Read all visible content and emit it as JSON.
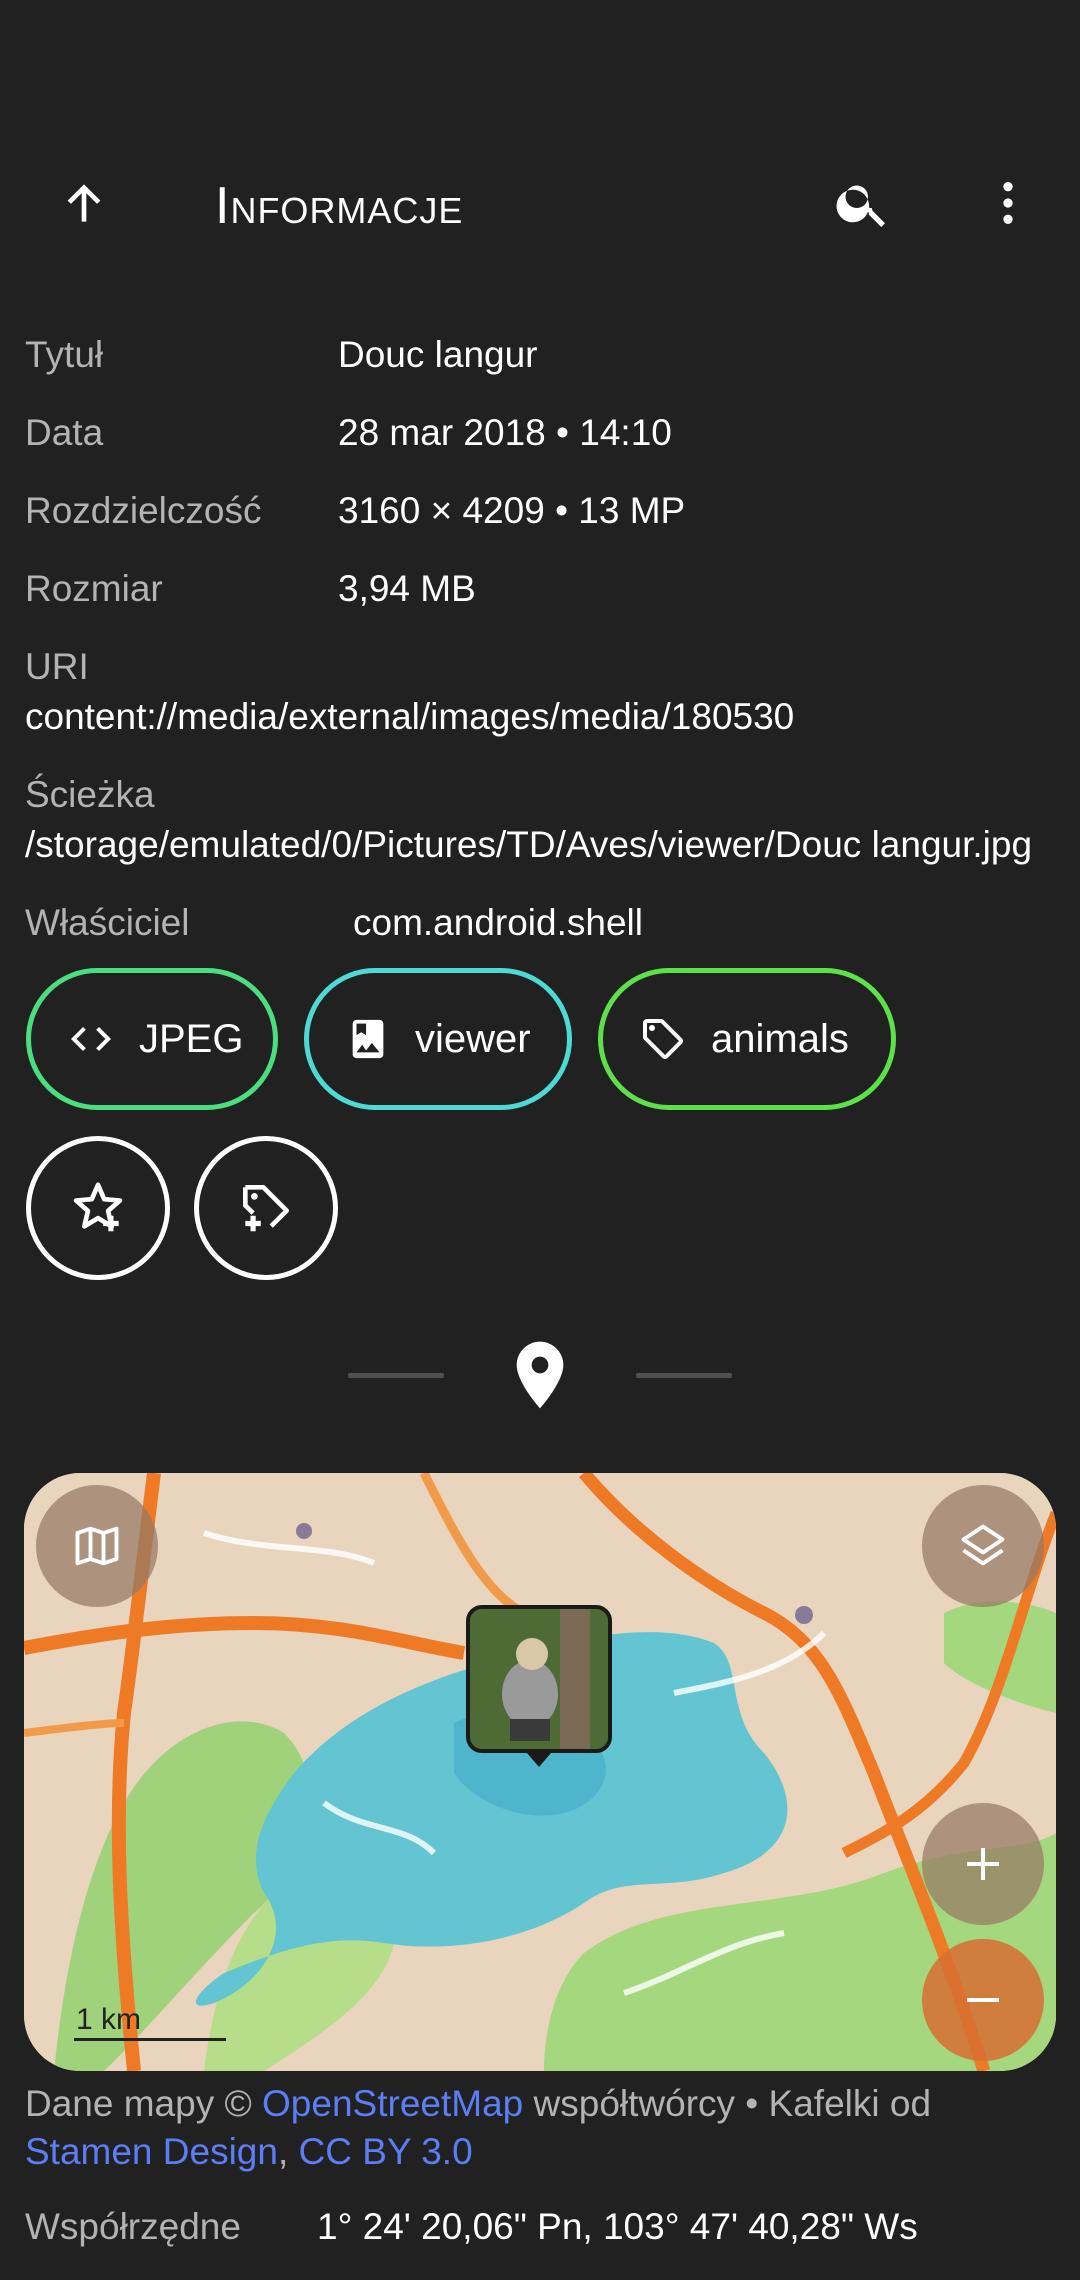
{
  "app_bar": {
    "title": "Informacje",
    "back_icon": "arrow-up-icon",
    "search_icon": "search-icon",
    "menu_icon": "more-vert-icon"
  },
  "info": {
    "title": {
      "label": "Tytuł",
      "value": "Douc langur"
    },
    "date": {
      "label": "Data",
      "value": "28 mar 2018 • 14:10"
    },
    "resolution": {
      "label": "Rozdzielczość",
      "value": "3160 × 4209 • 13 MP"
    },
    "size": {
      "label": "Rozmiar",
      "value": "3,94 MB"
    },
    "uri": {
      "label": "URI",
      "value": "content://media/external/images/media/180530"
    },
    "path": {
      "label": "Ścieżka",
      "value": "/storage/emulated/0/Pictures/TD/Aves/viewer/Douc langur.jpg"
    },
    "owner": {
      "label": "Właściciel",
      "value": "com.android.shell"
    }
  },
  "chips": [
    {
      "label": "JPEG",
      "icon": "code-icon",
      "color": "#4ade80"
    },
    {
      "label": "viewer",
      "icon": "photo-album-icon",
      "color": "#4dd9d4"
    },
    {
      "label": "animals",
      "icon": "tag-icon",
      "color": "#5ee04a"
    }
  ],
  "actions": {
    "favourite_icon": "star-add-icon",
    "add_tag_icon": "tag-add-icon"
  },
  "location_icon": "location-pin-icon",
  "map": {
    "scale_label": "1 km",
    "style_icon": "map-icon",
    "layers_icon": "layers-icon",
    "zoom_in_icon": "plus-icon",
    "zoom_out_icon": "minus-icon",
    "marker": "photo-thumbnail"
  },
  "attribution": {
    "prefix": "Dane mapy © ",
    "osm_link": "OpenStreetMap",
    "middle": " współtwórcy • Kafelki od ",
    "stamen_link": "Stamen Design",
    "separator": ", ",
    "license_link": "CC BY 3.0"
  },
  "coordinates": {
    "label": "Współrzędne",
    "value": "1° 24' 20,06\" Pn, 103° 47' 40,28\" Ws"
  }
}
